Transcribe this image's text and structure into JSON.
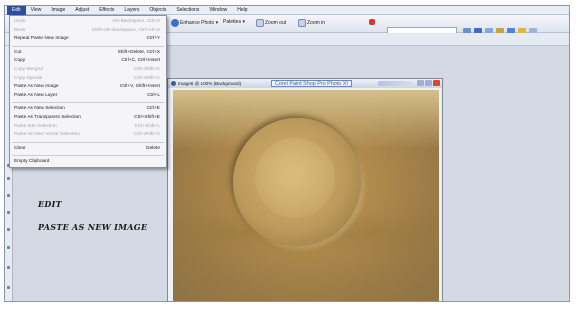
{
  "menubar": {
    "items": [
      "Edit",
      "View",
      "Image",
      "Adjust",
      "Effects",
      "Layers",
      "Objects",
      "Selections",
      "Window",
      "Help"
    ]
  },
  "toolbar": {
    "enhance_photo": "Enhance Photo ▾",
    "palettes": "Palettes ▾",
    "zoom_out": "Zoom out",
    "zoom_in": "Zoom in",
    "antialias": "Anti-alias"
  },
  "edit_menu": {
    "items": [
      {
        "label": "Undo",
        "shortcut": "Alt+Backspace, Ctrl+Z",
        "disabled": true
      },
      {
        "label": "Redo",
        "shortcut": "Shift+Alt+Backspace, Ctrl+Alt+Z",
        "disabled": true
      },
      {
        "label": "Repeat Paste New Image",
        "shortcut": "Ctrl+Y",
        "disabled": false
      },
      {
        "sep": true
      },
      {
        "label": "Cut",
        "shortcut": "Shift+Delete, Ctrl+X",
        "disabled": false
      },
      {
        "label": "Copy",
        "shortcut": "Ctrl+C, Ctrl+Insert",
        "disabled": false
      },
      {
        "label": "Copy Merged",
        "shortcut": "Ctrl+Shift+C",
        "disabled": true
      },
      {
        "label": "Copy Special",
        "shortcut": "Ctrl+Shift+C",
        "disabled": true
      },
      {
        "label": "Paste As New Image",
        "shortcut": "Ctrl+V, Shift+Insert",
        "disabled": false
      },
      {
        "label": "Paste As New Layer",
        "shortcut": "Ctrl+L",
        "disabled": false
      },
      {
        "sep": true
      },
      {
        "label": "Paste As New Selection",
        "shortcut": "Ctrl+E",
        "disabled": false
      },
      {
        "label": "Paste As Transparent Selection",
        "shortcut": "Ctrl+Shift+E",
        "disabled": false
      },
      {
        "label": "Paste Into Selection",
        "shortcut": "Ctrl+Shift+L",
        "disabled": true
      },
      {
        "label": "Paste As New Vector Selection",
        "shortcut": "Ctrl+Shift+G",
        "disabled": true
      },
      {
        "sep": true
      },
      {
        "label": "Clear",
        "shortcut": "Delete",
        "disabled": false
      },
      {
        "sep": true
      },
      {
        "label": "Empty Clipboard",
        "shortcut": "",
        "disabled": false
      }
    ]
  },
  "annotations": {
    "line1": "EDIT",
    "line2": "PASTE AS NEW IMAGE"
  },
  "image_window": {
    "title": "Image8 @ 100% (Background)",
    "watermark": "Corel Paint Shop Pro Photo XI"
  },
  "colors": {
    "menu_active": "#2d4f9e",
    "watermark": "#4760a8"
  }
}
